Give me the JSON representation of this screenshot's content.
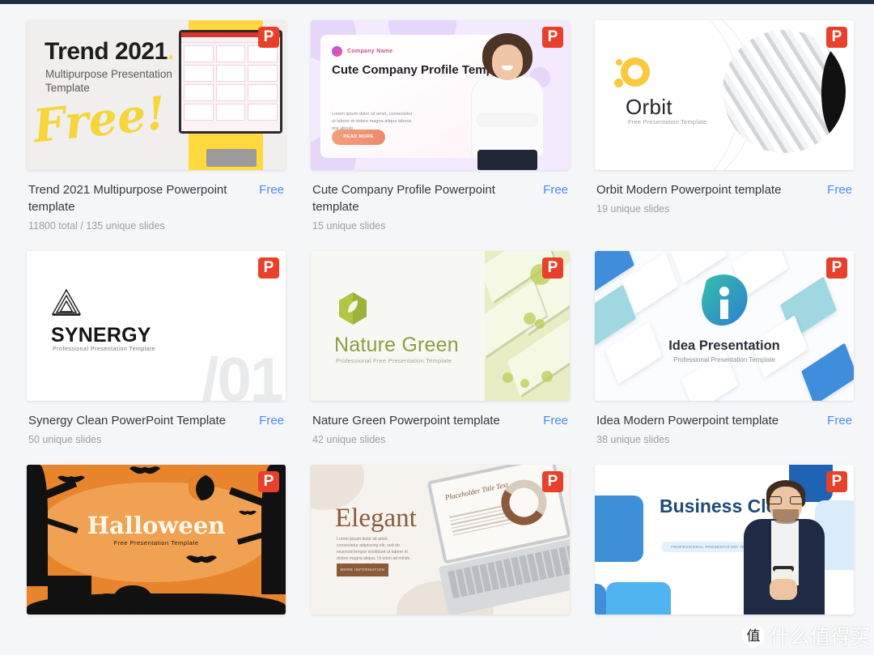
{
  "page": {
    "background_color": "#f5f6f7",
    "topbar_color": "#1f2d44",
    "accent_link_color": "#4a8cf5",
    "badge_color": "#e8402a",
    "badge_label": "P"
  },
  "watermark": {
    "mark": "值",
    "text": "什么值得买"
  },
  "cards": [
    {
      "title": "Trend 2021 Multipurpose Powerpoint template",
      "price": "Free",
      "slides": "11800 total / 135 unique slides",
      "badge": "P",
      "thumb": {
        "headline": "Trend 2021",
        "headline_dot": ".",
        "subtitle": "Multipurpose Presentation Template",
        "script_word": "Free!"
      }
    },
    {
      "title": "Cute Company Profile Powerpoint template",
      "price": "Free",
      "slides": "15 unique slides",
      "badge": "P",
      "thumb": {
        "company_label": "Company Name",
        "headline": "Cute Company Profile Template",
        "lorem": "Lorem ipsum dolor sit amet, consectetur ut labore et dolore magna aliqua laboris nisi aliquip",
        "button": "READ MORE"
      }
    },
    {
      "title": "Orbit Modern Powerpoint template",
      "price": "Free",
      "slides": "19 unique slides",
      "badge": "P",
      "thumb": {
        "headline": "Orbit",
        "subtitle": "Free Presentation Template"
      }
    },
    {
      "title": "Synergy Clean PowerPoint Template",
      "price": "Free",
      "slides": "50 unique slides",
      "badge": "P",
      "thumb": {
        "headline": "SYNERGY",
        "subtitle": "Professional Presentation Template",
        "watermark_number": "/01"
      }
    },
    {
      "title": "Nature Green Powerpoint template",
      "price": "Free",
      "slides": "42 unique slides",
      "badge": "P",
      "thumb": {
        "headline": "Nature Green",
        "subtitle": "Professional Free Presentation Template"
      }
    },
    {
      "title": "Idea Modern Powerpoint template",
      "price": "Free",
      "slides": "38 unique slides",
      "badge": "P",
      "thumb": {
        "headline": "Idea Presentation",
        "subtitle": "Professional Presentation Template"
      }
    },
    {
      "title": "",
      "price": "",
      "slides": "",
      "badge": "P",
      "thumb": {
        "headline": "Halloween",
        "subtitle": "Free Presentation Template"
      }
    },
    {
      "title": "",
      "price": "",
      "slides": "",
      "badge": "P",
      "thumb": {
        "headline": "Elegant",
        "lorem": "Lorem ipsum dolor sit amet, consectetur adipiscing elit, sed do eiusmod tempor incididunt ut labore et dolore magna aliqua. Ut enim ad minim veniam quis nostrud.",
        "button": "MORE INFORMATION",
        "screen_title": "Placeholder Title Text"
      }
    },
    {
      "title": "",
      "price": "",
      "slides": "",
      "badge": "P",
      "thumb": {
        "headline": "Business Clean",
        "badge_text": "PROFESSIONAL PRESENTATION TEMPLATE"
      }
    }
  ]
}
